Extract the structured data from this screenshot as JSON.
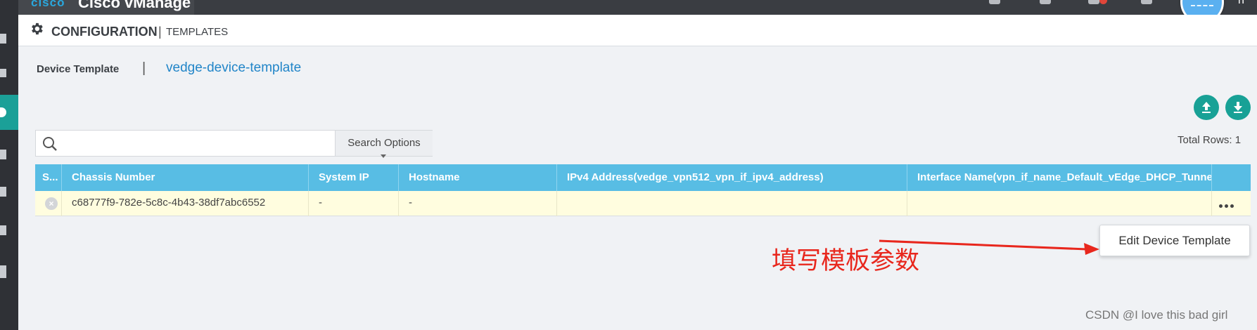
{
  "topbar": {
    "brand_logo": "cisco",
    "brand_product": "Cisco vManage",
    "icons": [
      "monitor-icon",
      "clipboard-icon",
      "bell-icon",
      "help-icon"
    ],
    "user_text": "n"
  },
  "header": {
    "title": "CONFIGURATION",
    "separator": "|",
    "subtitle": "TEMPLATES"
  },
  "breadcrumb": {
    "label": "Device Template",
    "separator": "|",
    "link": "vedge-device-template"
  },
  "actions": {
    "upload_icon": "upload-icon",
    "download_icon": "download-icon"
  },
  "search": {
    "placeholder": "",
    "value": "",
    "options_label": "Search Options"
  },
  "table": {
    "total_rows": "Total Rows: 1",
    "columns": [
      "S...",
      "Chassis Number",
      "System IP",
      "Hostname",
      "IPv4 Address(vedge_vpn512_vpn_if_ipv4_address)",
      "Interface Name(vpn_if_name_Default_vEdge_DHCP_Tunnel_Interface)"
    ],
    "rows": [
      {
        "status_icon": "error-x-icon",
        "chassis": "c68777f9-782e-5c8c-4b43-38df7abc6552",
        "system_ip": "-",
        "hostname": "-",
        "ipv4": "",
        "interface": ""
      }
    ]
  },
  "popup": {
    "label": "Edit Device Template"
  },
  "annotation": {
    "text": "填写模板参数",
    "color": "#e8271d"
  },
  "watermark": "CSDN @I love this bad girl",
  "colors": {
    "accent": "#18a196",
    "table_header": "#58bde4",
    "link": "#2185c8",
    "row_highlight": "#fffddf"
  }
}
